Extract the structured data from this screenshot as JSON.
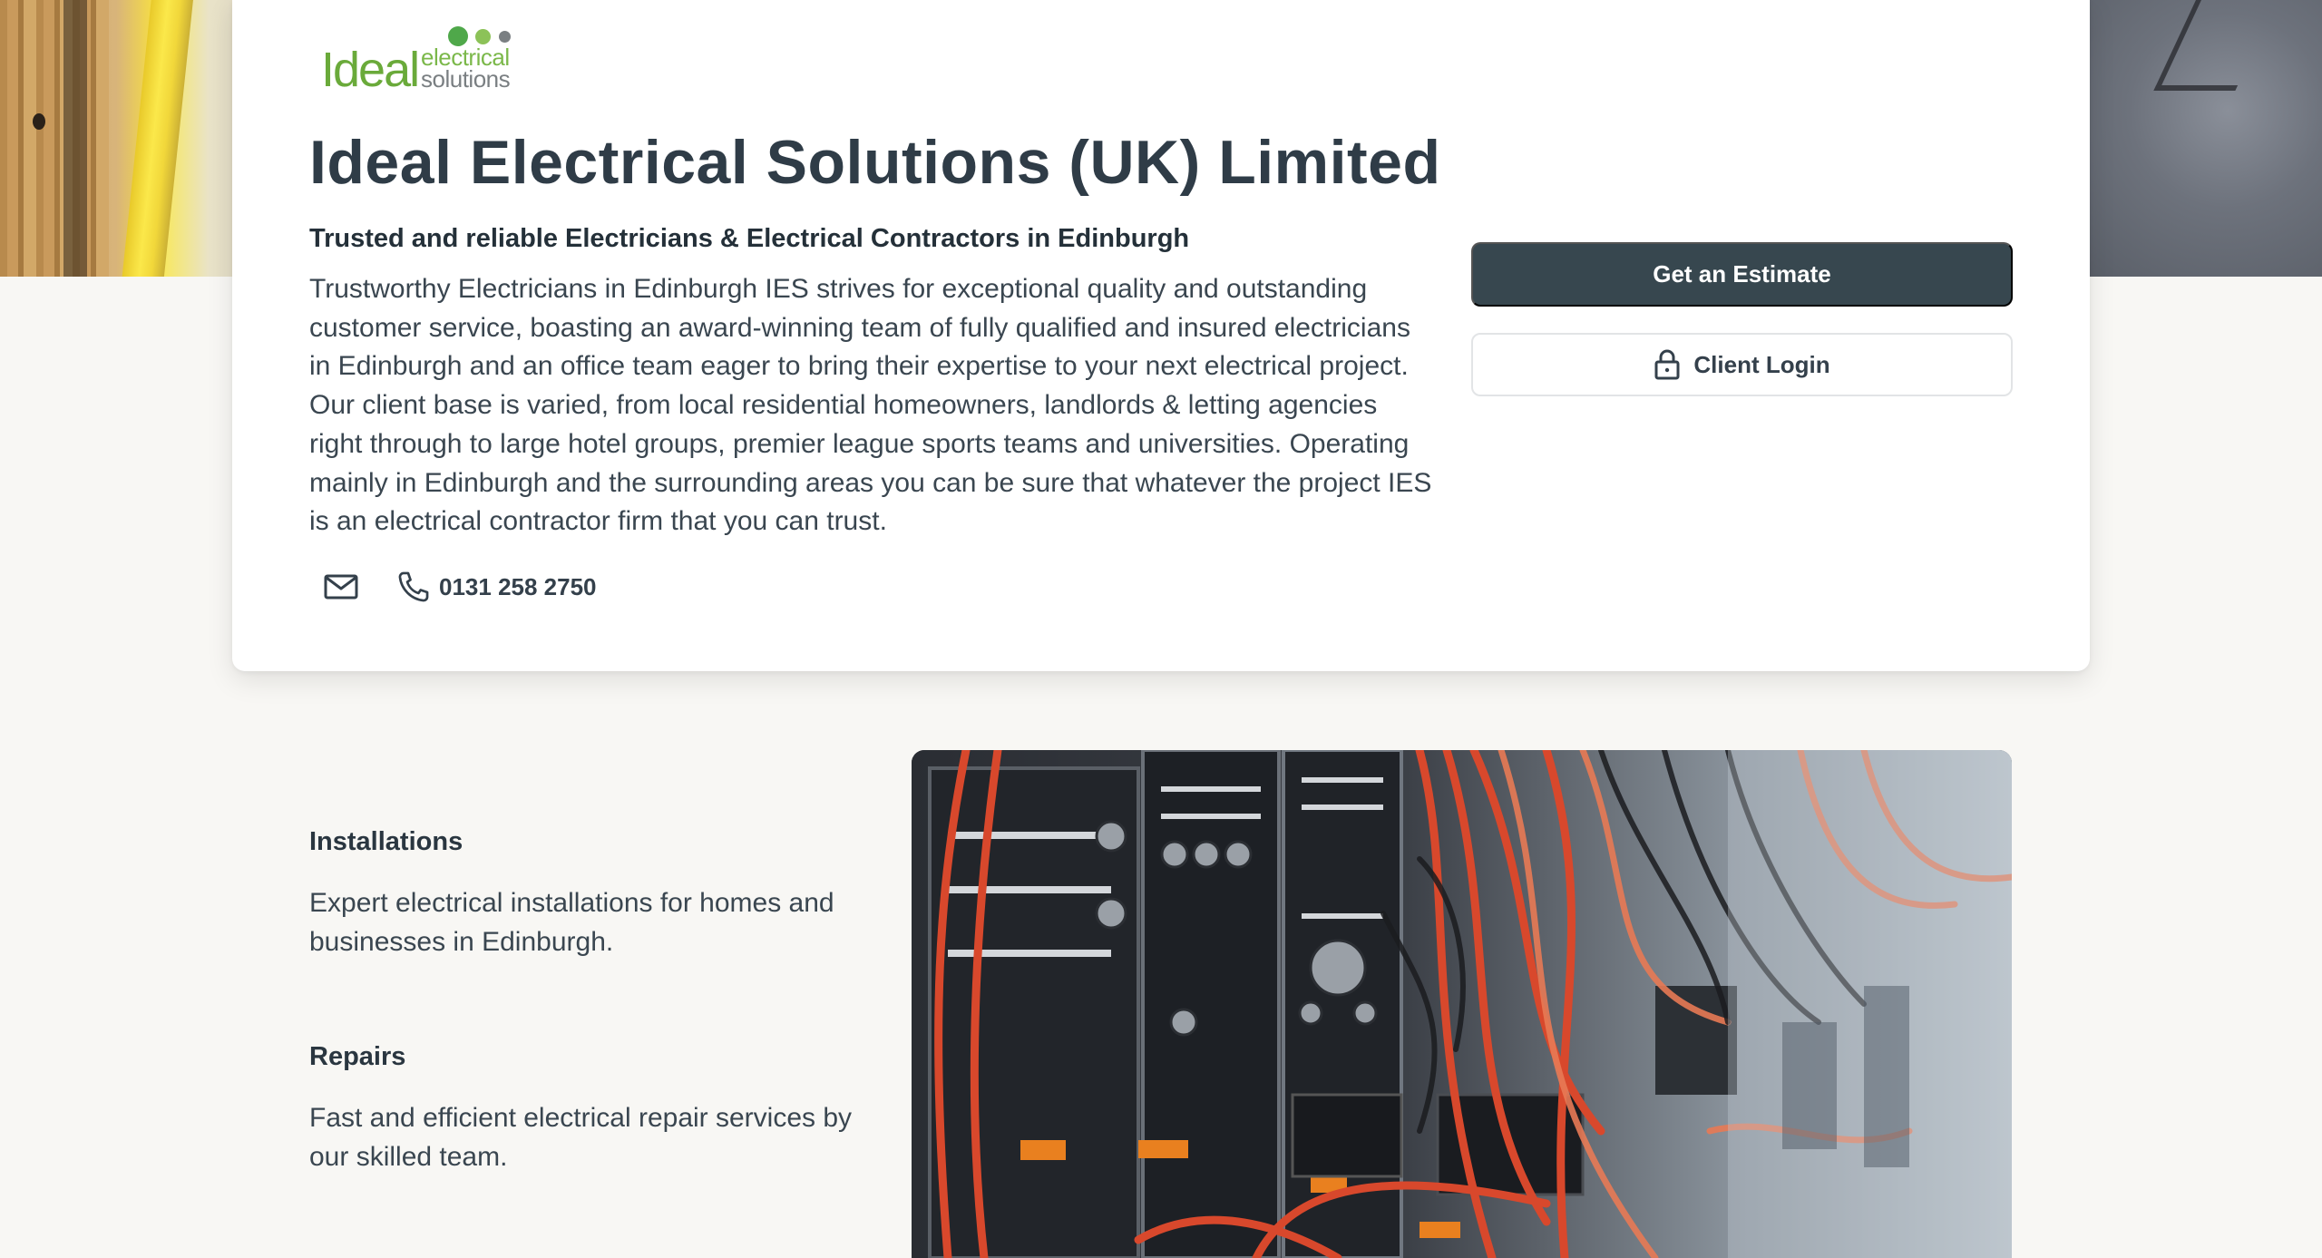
{
  "hero": {
    "image": "construction-wiring-banner"
  },
  "logo": {
    "word1": "Ideal",
    "word2": "electrical",
    "word3": "solutions",
    "colors": {
      "green": "#6aaa3a",
      "light_green": "#8cc258",
      "grey": "#7a7f82"
    }
  },
  "header": {
    "title": "Ideal Electrical Solutions (UK) Limited",
    "subtitle": "Trusted and reliable Electricians & Electrical Contractors in Edinburgh",
    "description": "Trustworthy Electricians in Edinburgh IES strives for exceptional quality and outstanding customer service, boasting an award-winning team of fully qualified and insured electricians in Edinburgh and an office team eager to bring their expertise to your next electrical project. Our client base is varied, from local residential homeowners, landlords & letting agencies right through to large hotel groups, premier league sports teams and universities. Operating mainly in Edinburgh and the surrounding areas you can be sure that whatever the project IES is an electrical contractor firm that you can trust."
  },
  "contact": {
    "email_icon": "envelope-icon",
    "phone_icon": "phone-icon",
    "phone": "0131 258 2750"
  },
  "actions": {
    "estimate_label": "Get an Estimate",
    "login_label": "Client Login",
    "login_icon": "lock-icon",
    "estimate_color": "#37474f"
  },
  "services": [
    {
      "title": "Installations",
      "text": "Expert electrical installations for homes and businesses in Edinburgh."
    },
    {
      "title": "Repairs",
      "text": "Fast and efficient electrical repair services by our skilled team."
    }
  ],
  "feature_image": {
    "image": "electrical-panel-wiring-photo"
  }
}
